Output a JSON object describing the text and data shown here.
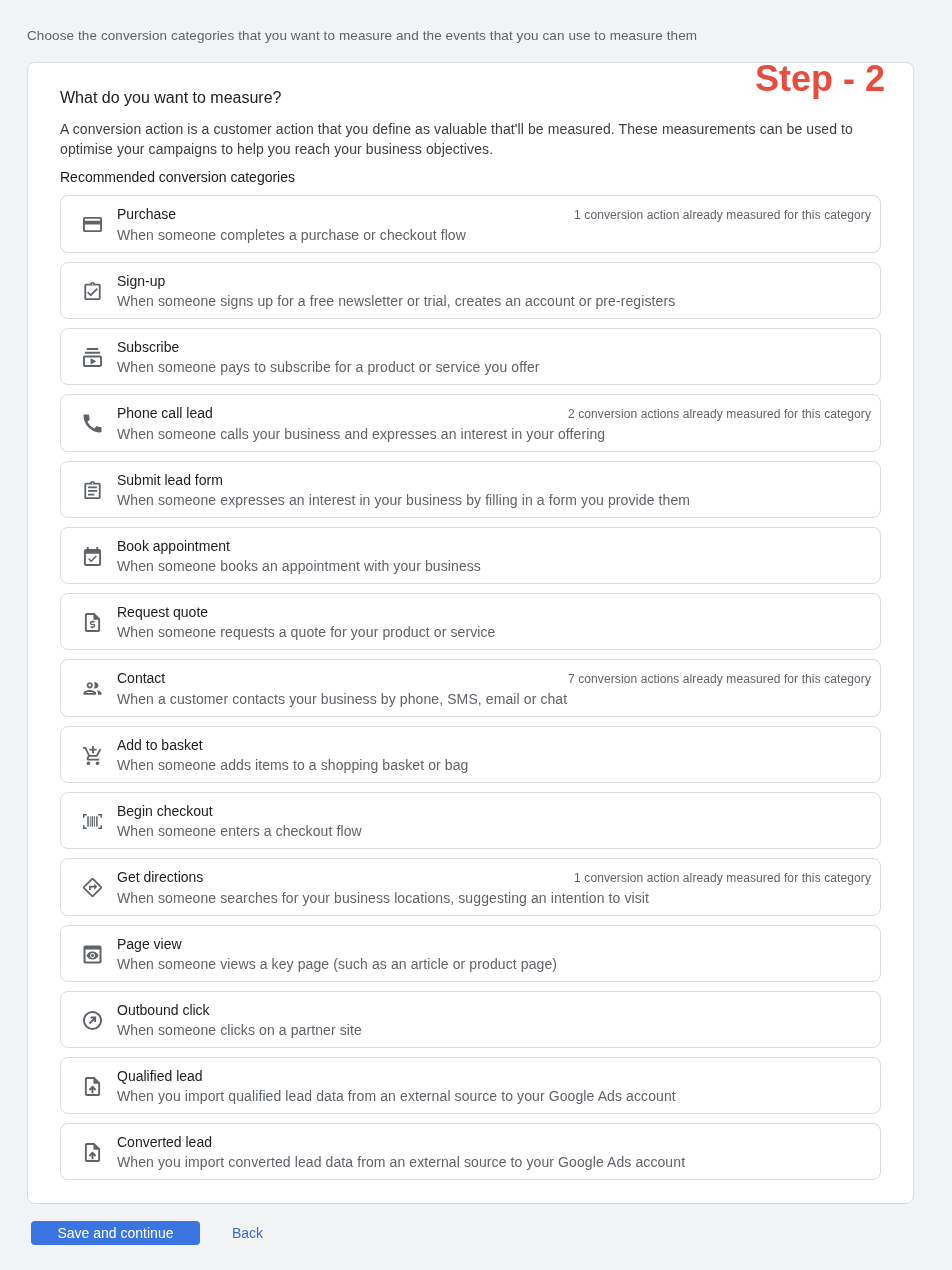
{
  "intro": "Choose the conversion categories that you want to measure and the events that you can use to measure them",
  "annotation": "Step - 2",
  "card": {
    "title": "What do you want to measure?",
    "description": "A conversion action is a customer action that you define as valuable that'll be measured. These measurements can be used to optimise your campaigns to help you reach your business objectives.",
    "list_heading": "Recommended conversion categories",
    "categories": [
      {
        "title": "Purchase",
        "description": "When someone completes a purchase or checkout flow",
        "note": "1 conversion action already measured for this category"
      },
      {
        "title": "Sign-up",
        "description": "When someone signs up for a free newsletter or trial, creates an account or pre-registers"
      },
      {
        "title": "Subscribe",
        "description": "When someone pays to subscribe for a product or service you offer"
      },
      {
        "title": "Phone call lead",
        "description": "When someone calls your business and expresses an interest in your offering",
        "note": "2 conversion actions already measured for this category"
      },
      {
        "title": "Submit lead form",
        "description": "When someone expresses an interest in your business by filling in a form you provide them"
      },
      {
        "title": "Book appointment",
        "description": "When someone books an appointment with your business"
      },
      {
        "title": "Request quote",
        "description": "When someone requests a quote for your product or service"
      },
      {
        "title": "Contact",
        "description": "When a customer contacts your business by phone, SMS, email or chat",
        "note": "7 conversion actions already measured for this category"
      },
      {
        "title": "Add to basket",
        "description": "When someone adds items to a shopping basket or bag"
      },
      {
        "title": "Begin checkout",
        "description": "When someone enters a checkout flow"
      },
      {
        "title": "Get directions",
        "description": "When someone searches for your business locations, suggesting an intention to visit",
        "note": "1 conversion action already measured for this category"
      },
      {
        "title": "Page view",
        "description": "When someone views a key page (such as an article or product page)"
      },
      {
        "title": "Outbound click",
        "description": "When someone clicks on a partner site"
      },
      {
        "title": "Qualified lead",
        "description": "When you import qualified lead data from an external source to your Google Ads account"
      },
      {
        "title": "Converted lead",
        "description": "When you import converted lead data from an external source to your Google Ads account"
      }
    ]
  },
  "buttons": [
    {
      "label": "Save and continue",
      "kind": "primary"
    },
    {
      "label": "Back",
      "kind": "link"
    }
  ]
}
